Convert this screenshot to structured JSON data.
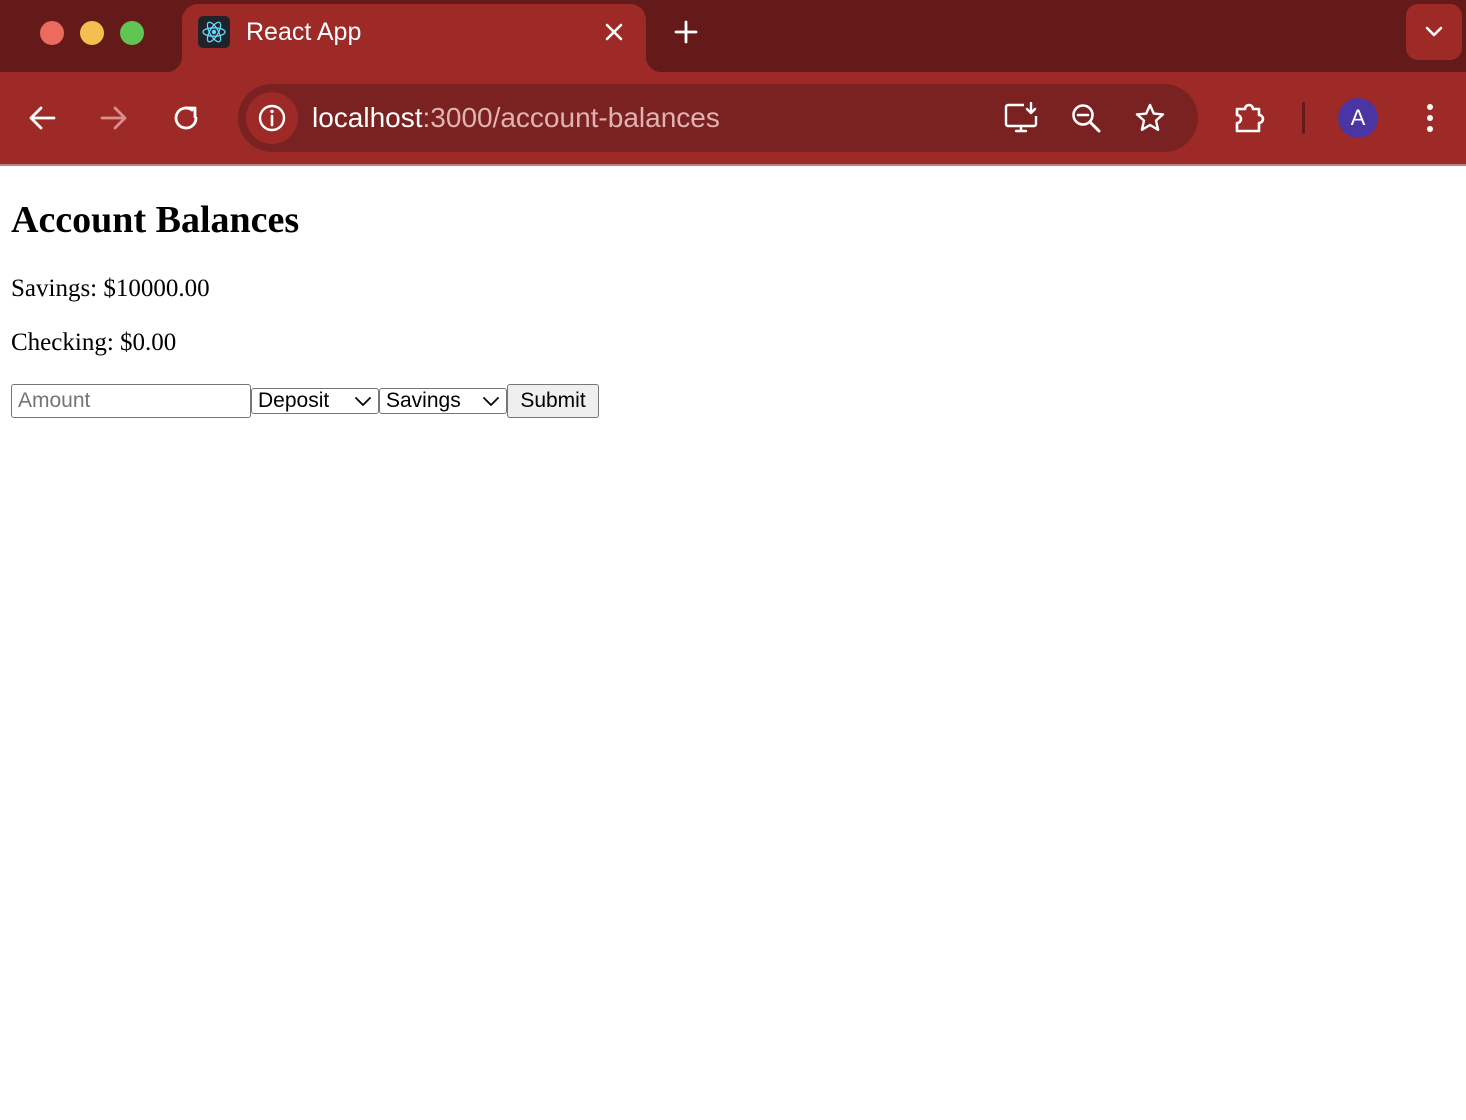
{
  "browser": {
    "tab": {
      "title": "React App",
      "favicon": "react-logo-icon"
    },
    "url": {
      "host": "localhost",
      "path": ":3000/account-balances"
    },
    "profile_initial": "A",
    "colors": {
      "tabstrip": "#631a19",
      "toolbar": "#9d2a26",
      "omnibox": "#7a2221",
      "avatar": "#4a35a3"
    },
    "icons": {
      "back": "arrow-left-icon",
      "forward": "arrow-right-icon",
      "reload": "reload-icon",
      "site_info": "info-icon",
      "install": "install-app-icon",
      "zoom": "zoom-out-icon",
      "bookmark": "star-icon",
      "extensions": "puzzle-icon",
      "menu": "kebab-menu-icon",
      "tab_search": "chevron-down-icon"
    }
  },
  "page": {
    "title": "Account Balances",
    "balances": {
      "savings": "Savings: $10000.00",
      "checking": "Checking: $0.00"
    },
    "form": {
      "amount_placeholder": "Amount",
      "amount_value": "",
      "transaction_type": "Deposit",
      "account": "Savings",
      "submit_label": "Submit"
    }
  }
}
